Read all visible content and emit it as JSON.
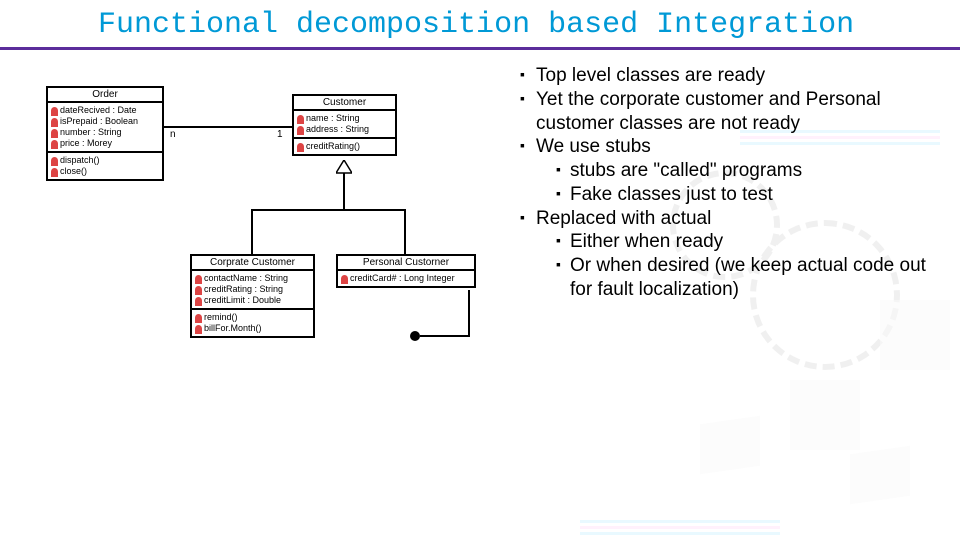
{
  "title": "Functional decomposition based Integration",
  "uml": {
    "order": {
      "name": "Order",
      "attrs": [
        "dateRecived : Date",
        "isPrepaid : Boolean",
        "number : String",
        "price : Morey"
      ],
      "ops": [
        "dispatch()",
        "close()"
      ]
    },
    "customer": {
      "name": "Customer",
      "attrs": [
        "name : String",
        "address : String"
      ],
      "ops": [
        "creditRating()"
      ]
    },
    "corporate": {
      "name": "Corprate Customer",
      "attrs": [
        "contactName : String",
        "creditRating : String",
        "creditLimit : Double"
      ],
      "ops": [
        "remind()",
        "billFor.Month()"
      ]
    },
    "personal": {
      "name": "Personal Custorner",
      "attrs": [
        "creditCard# : Long Integer"
      ]
    },
    "mult": {
      "left": "n",
      "right": "1"
    }
  },
  "bullets": {
    "b1": "Top level classes are ready",
    "b2": "Yet the corporate customer and Personal customer classes are not ready",
    "b3": "We use stubs",
    "b3a": "stubs are \"called\" programs",
    "b3b": "Fake classes just to test",
    "b4": "Replaced with actual",
    "b4a": "Either when ready",
    "b4b": "Or when desired (we keep actual code out for fault localization)"
  }
}
